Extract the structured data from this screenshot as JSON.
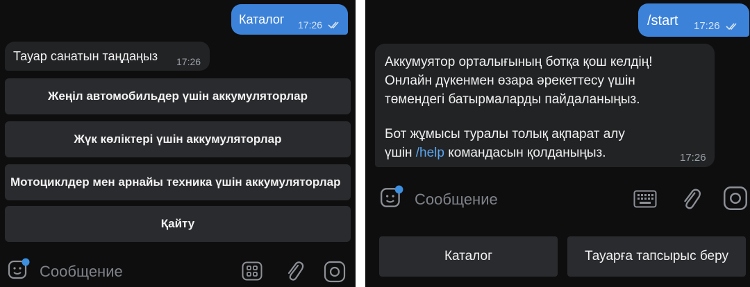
{
  "left": {
    "outgoing": {
      "text": "Каталог",
      "time": "17:26"
    },
    "incoming": {
      "text": "Тауар санатын таңдаңыз",
      "time": "17:26"
    },
    "keyboard": [
      "Жеңіл автомобильдер үшін аккумуляторлар",
      "Жүк көліктері үшін аккумуляторлар",
      "Мотоциклдер мен арнайы техника үшін аккумуляторлар",
      "Қайту"
    ],
    "input_placeholder": "Сообщение"
  },
  "right": {
    "outgoing": {
      "text": "/start",
      "time": "17:26"
    },
    "incoming": {
      "paragraph1": "Аккумуятор орталығының ботқа қош келдің!\nОнлайн дүкенмен өзара әрекеттесу үшін\nтөмендегі батырмаларды пайдаланыңыз.",
      "paragraph2_line1": "Бот жұмысы туралы толық ақпарат алу",
      "paragraph2_prefix": "үшін ",
      "paragraph2_command": "/help",
      "paragraph2_suffix": " командасын қолданыңыз.",
      "time": "17:26"
    },
    "input_placeholder": "Сообщение",
    "reply_keyboard": [
      "Каталог",
      "Тауарға тапсырыс беру"
    ]
  },
  "colors": {
    "background": "#0e0e0f",
    "outgoing_bubble": "#3c82d8",
    "incoming_bubble": "#222325",
    "keyboard_button": "#2a2b2e",
    "link": "#5aa6ef",
    "icon": "#8d9197",
    "badge": "#3d8fe0"
  },
  "icons": [
    "double-check-icon",
    "sticker-icon",
    "bot-keyboard-icon",
    "keyboard-icon",
    "paperclip-icon",
    "camera-icon"
  ]
}
